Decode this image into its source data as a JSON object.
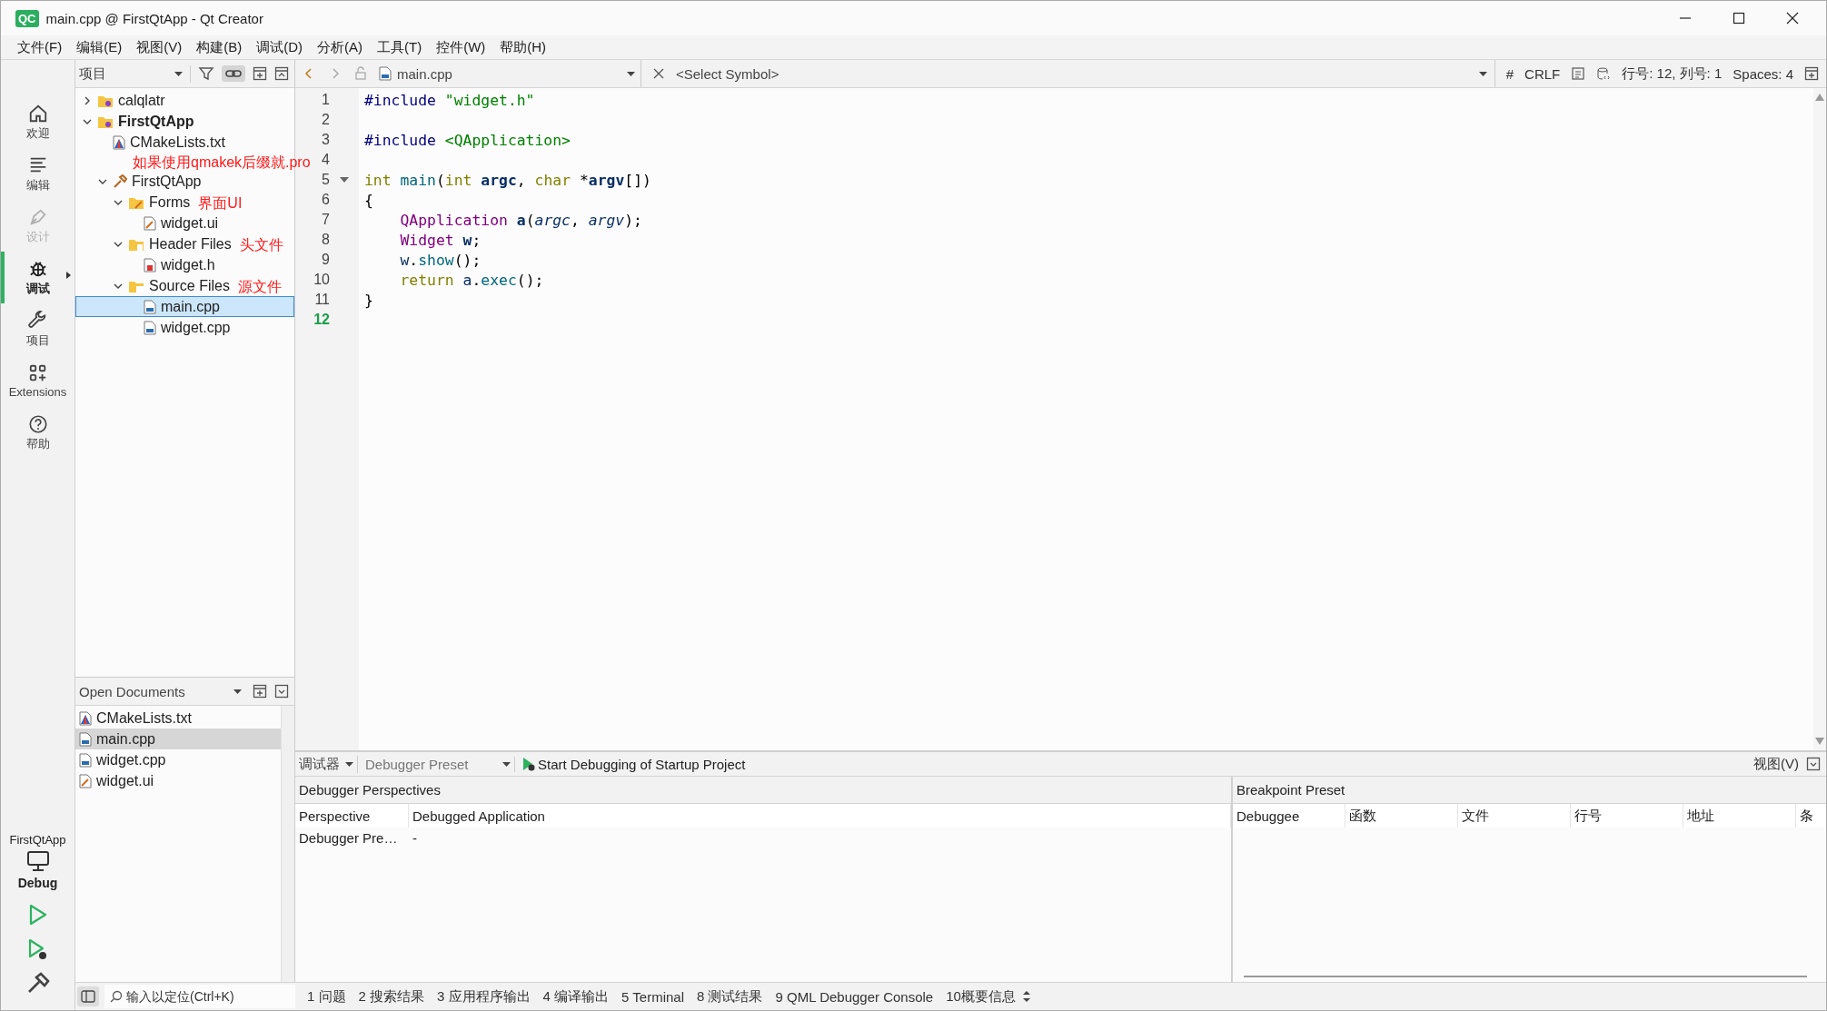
{
  "window": {
    "logo_text": "QC",
    "title": "main.cpp @ FirstQtApp - Qt Creator"
  },
  "menu": [
    "文件(F)",
    "编辑(E)",
    "视图(V)",
    "构建(B)",
    "调试(D)",
    "分析(A)",
    "工具(T)",
    "控件(W)",
    "帮助(H)"
  ],
  "mode_bar": {
    "items": [
      {
        "kind": "home",
        "label": "欢迎",
        "selected": false,
        "disabled": false
      },
      {
        "kind": "edit",
        "label": "编辑",
        "selected": false,
        "disabled": false
      },
      {
        "kind": "design",
        "label": "设计",
        "selected": false,
        "disabled": true
      },
      {
        "kind": "debug",
        "label": "调试",
        "selected": true,
        "disabled": false
      },
      {
        "kind": "wrench",
        "label": "项目",
        "selected": false,
        "disabled": false
      },
      {
        "kind": "extensions",
        "label": "Extensions",
        "selected": false,
        "disabled": false
      },
      {
        "kind": "help",
        "label": "帮助",
        "selected": false,
        "disabled": false
      }
    ],
    "target": {
      "project": "FirstQtApp",
      "config": "Debug"
    }
  },
  "project_panel": {
    "view": "项目",
    "tree": [
      {
        "kind": "project",
        "name": "calqlatr",
        "expanded": false,
        "selected": false
      },
      {
        "kind": "project",
        "name": "FirstQtApp",
        "expanded": true,
        "selected": false,
        "children": [
          {
            "kind": "cmake",
            "name": "CMakeLists.txt",
            "selected": false,
            "note": "如果使用qmakek后缀就.pro"
          },
          {
            "kind": "target",
            "name": "FirstQtApp",
            "expanded": true,
            "selected": false,
            "children": [
              {
                "kind": "forms",
                "name": "Forms",
                "expanded": true,
                "selected": false,
                "note": "界面UI",
                "children": [
                  {
                    "kind": "ui",
                    "name": "widget.ui",
                    "selected": false
                  }
                ]
              },
              {
                "kind": "headers",
                "name": "Header Files",
                "expanded": true,
                "selected": false,
                "note": "头文件",
                "children": [
                  {
                    "kind": "h",
                    "name": "widget.h",
                    "selected": false
                  }
                ]
              },
              {
                "kind": "sources",
                "name": "Source Files",
                "expanded": true,
                "selected": false,
                "note": "源文件",
                "children": [
                  {
                    "kind": "cpp",
                    "name": "main.cpp",
                    "selected": true
                  },
                  {
                    "kind": "cpp",
                    "name": "widget.cpp",
                    "selected": false
                  }
                ]
              }
            ]
          }
        ]
      }
    ]
  },
  "open_documents": {
    "title": "Open Documents",
    "items": [
      {
        "kind": "cmake",
        "name": "CMakeLists.txt",
        "selected": false
      },
      {
        "kind": "cpp",
        "name": "main.cpp",
        "selected": true
      },
      {
        "kind": "cpp",
        "name": "widget.cpp",
        "selected": false
      },
      {
        "kind": "ui",
        "name": "widget.ui",
        "selected": false
      }
    ]
  },
  "editor": {
    "file": "main.cpp",
    "symbol": "<Select Symbol>",
    "hash": "#",
    "line_ending": "CRLF",
    "position": "行号: 12, 列号: 1",
    "indent": "Spaces: 4",
    "lines": [
      {
        "number": "1",
        "current": false,
        "foldable": false,
        "tokens": [
          {
            "kind": "preproc",
            "text": "#include "
          },
          {
            "kind": "string",
            "text": "\"widget.h\""
          }
        ]
      },
      {
        "number": "2",
        "current": false,
        "foldable": false
      },
      {
        "number": "3",
        "current": false,
        "foldable": false,
        "tokens": [
          {
            "kind": "preproc",
            "text": "#include "
          },
          {
            "kind": "string",
            "text": "<QApplication>"
          }
        ]
      },
      {
        "number": "4",
        "current": false,
        "foldable": false
      },
      {
        "number": "5",
        "current": false,
        "foldable": true,
        "tokens": [
          {
            "kind": "keyword",
            "text": "int "
          },
          {
            "kind": "func",
            "text": "main"
          },
          {
            "kind": "plain",
            "text": "("
          },
          {
            "kind": "keyword",
            "text": "int "
          },
          {
            "kind": "decl",
            "text": "argc"
          },
          {
            "kind": "plain",
            "text": ", "
          },
          {
            "kind": "keyword",
            "text": "char "
          },
          {
            "kind": "plain",
            "text": "*"
          },
          {
            "kind": "decl",
            "text": "argv"
          },
          {
            "kind": "plain",
            "text": "[])"
          }
        ]
      },
      {
        "number": "6",
        "current": false,
        "foldable": false,
        "tokens": [
          {
            "kind": "plain",
            "text": "{"
          }
        ]
      },
      {
        "number": "7",
        "current": false,
        "foldable": false,
        "tokens": [
          {
            "kind": "type",
            "text": "    QApplication "
          },
          {
            "kind": "decl",
            "text": "a"
          },
          {
            "kind": "plain",
            "text": "("
          },
          {
            "kind": "param",
            "text": "argc"
          },
          {
            "kind": "plain",
            "text": ", "
          },
          {
            "kind": "param",
            "text": "argv"
          },
          {
            "kind": "plain",
            "text": ");"
          }
        ]
      },
      {
        "number": "8",
        "current": false,
        "foldable": false,
        "tokens": [
          {
            "kind": "type",
            "text": "    Widget "
          },
          {
            "kind": "decl",
            "text": "w"
          },
          {
            "kind": "plain",
            "text": ";"
          }
        ]
      },
      {
        "number": "9",
        "current": false,
        "foldable": false,
        "tokens": [
          {
            "kind": "local",
            "text": "    w"
          },
          {
            "kind": "plain",
            "text": "."
          },
          {
            "kind": "func",
            "text": "show"
          },
          {
            "kind": "plain",
            "text": "();"
          }
        ]
      },
      {
        "number": "10",
        "current": false,
        "foldable": false,
        "tokens": [
          {
            "kind": "keyword",
            "text": "    return "
          },
          {
            "kind": "local",
            "text": "a"
          },
          {
            "kind": "plain",
            "text": "."
          },
          {
            "kind": "func",
            "text": "exec"
          },
          {
            "kind": "plain",
            "text": "();"
          }
        ]
      },
      {
        "number": "11",
        "current": false,
        "foldable": false,
        "tokens": [
          {
            "kind": "plain",
            "text": "}"
          }
        ]
      },
      {
        "number": "12",
        "current": true,
        "foldable": false
      }
    ]
  },
  "debugger": {
    "engine": "调试器",
    "preset": "Debugger Preset",
    "start": "Start Debugging of Startup Project",
    "view_menu": "视图(V)",
    "perspectives": {
      "title": "Debugger Perspectives",
      "columns": [
        "Perspective",
        "Debugged Application"
      ],
      "rows": [
        [
          "Debugger Pre…",
          "-"
        ]
      ]
    },
    "breakpoints": {
      "title": "Breakpoint Preset",
      "columns": [
        "Debuggee",
        "函数",
        "文件",
        "行号",
        "地址",
        "条"
      ]
    }
  },
  "status_bar": {
    "locator_placeholder": "输入以定位(Ctrl+K)",
    "output_tabs": [
      "1  问题",
      "2  搜索结果",
      "3  应用程序输出",
      "4  编译输出",
      "5  Terminal",
      "8  测试结果",
      "9  QML Debugger Console",
      "10概要信息"
    ]
  }
}
